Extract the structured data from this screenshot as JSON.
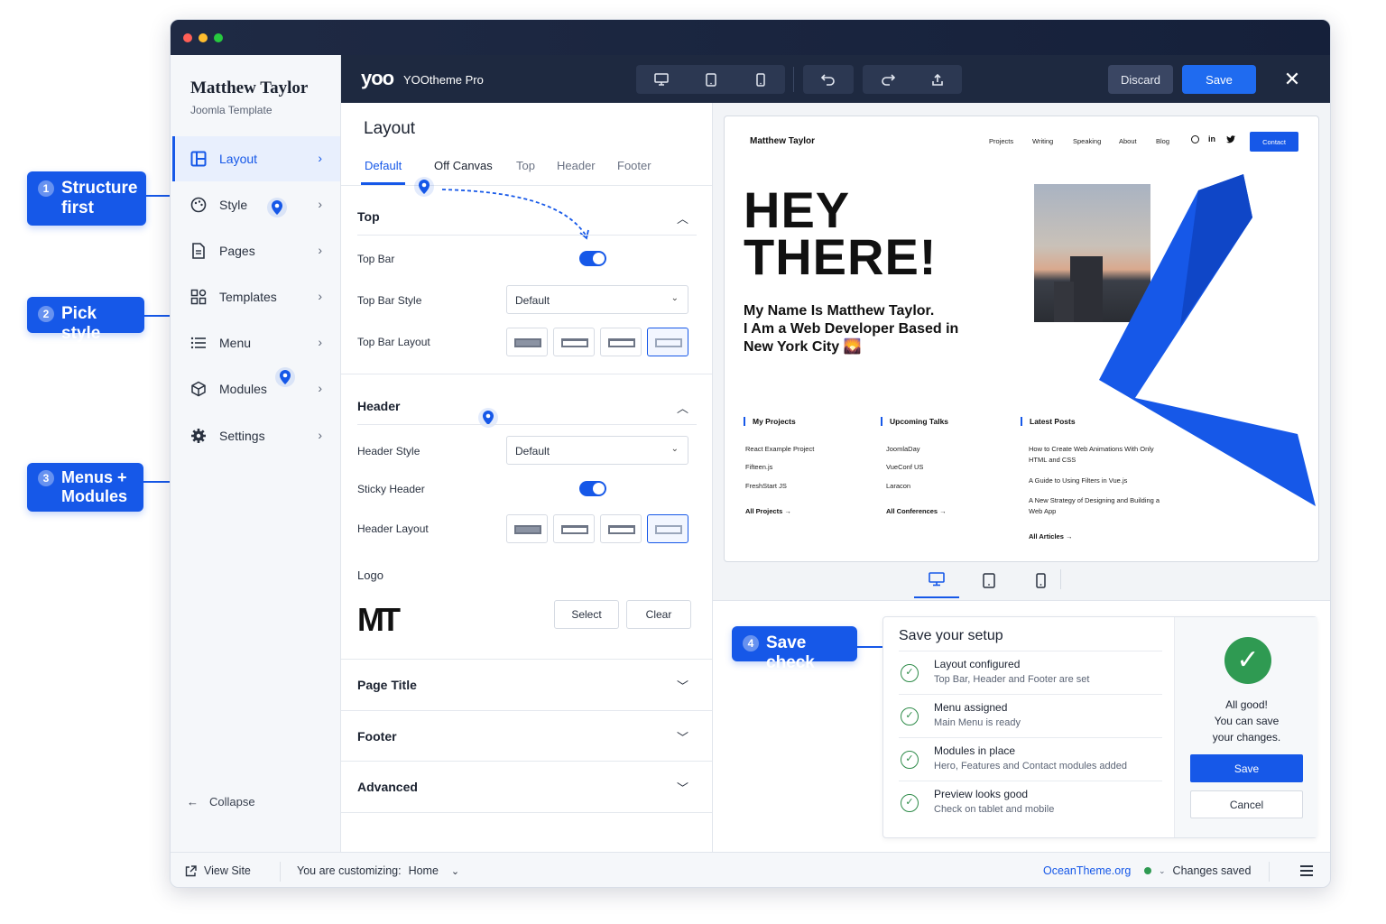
{
  "callouts": [
    {
      "num": "1",
      "text": "Structure\nfirst"
    },
    {
      "num": "2",
      "text": "Pick style"
    },
    {
      "num": "3",
      "text": "Menus +\nModules"
    },
    {
      "num": "4",
      "text": "Save check"
    }
  ],
  "sidebar": {
    "brand": "Matthew Taylor",
    "subtitle": "Joomla Template",
    "items": [
      {
        "label": "Layout",
        "icon": "layout-icon"
      },
      {
        "label": "Style",
        "icon": "palette-icon"
      },
      {
        "label": "Pages",
        "icon": "page-icon"
      },
      {
        "label": "Templates",
        "icon": "templates-icon"
      },
      {
        "label": "Menu",
        "icon": "menu-list-icon"
      },
      {
        "label": "Modules",
        "icon": "cube-icon"
      },
      {
        "label": "Settings",
        "icon": "gear-icon"
      }
    ],
    "collapse": "Collapse"
  },
  "toolbar": {
    "logo": "yoo",
    "product": "YOOtheme Pro",
    "discard": "Discard",
    "save": "Save"
  },
  "panel": {
    "title": "Layout",
    "tabs": [
      "Default",
      "Off Canvas",
      "Top",
      "Header",
      "Footer"
    ],
    "top": {
      "heading": "Top",
      "top_bar": "Top Bar",
      "top_bar_style": "Top Bar Style",
      "top_bar_style_value": "Default",
      "top_bar_layout": "Top Bar Layout"
    },
    "header": {
      "heading": "Header",
      "header_style": "Header Style",
      "header_style_value": "Default",
      "sticky_header": "Sticky Header",
      "header_layout": "Header Layout"
    },
    "logo": {
      "label": "Logo",
      "mark": "MT",
      "select": "Select",
      "clear": "Clear"
    },
    "collapsed_sections": [
      "Page Title",
      "Footer",
      "Advanced"
    ]
  },
  "preview": {
    "brand": "Matthew Taylor",
    "nav": [
      "Projects",
      "Writing",
      "Speaking",
      "About",
      "Blog"
    ],
    "contact": "Contact",
    "hero": "HEY\nTHERE!",
    "intro": "My Name Is Matthew Taylor.\nI Am a Web Developer Based in\nNew York City 🌄",
    "columns": [
      {
        "heading": "My Projects",
        "links": [
          "React Example Project",
          "Fifteen.js",
          "FreshStart JS"
        ],
        "all": "All Projects →"
      },
      {
        "heading": "Upcoming Talks",
        "links": [
          "JoomlaDay",
          "VueConf US",
          "Laracon"
        ],
        "all": "All Conferences →"
      },
      {
        "heading": "Latest Posts",
        "links": [
          "How to Create Web Animations With Only HTML and CSS",
          "A Guide to Using Filters in Vue.js",
          "A New Strategy of Designing and Building a Web App"
        ],
        "all": "All Articles →"
      }
    ]
  },
  "checklist": {
    "title": "Save your setup",
    "items": [
      {
        "title": "Layout configured",
        "sub": "Top Bar, Header and Footer are set"
      },
      {
        "title": "Menu assigned",
        "sub": "Main Menu is ready"
      },
      {
        "title": "Modules in place",
        "sub": "Hero, Features and Contact modules added"
      },
      {
        "title": "Preview looks good",
        "sub": "Check on tablet and mobile"
      }
    ],
    "status": "All good!\nYou can save\nyour changes.",
    "save": "Save",
    "cancel": "Cancel"
  },
  "footer": {
    "view_site": "View Site",
    "customizing_label": "You are customizing:",
    "customizing_value": "Home",
    "brand": "OceanTheme.org",
    "status": "Changes saved"
  },
  "colors": {
    "accent": "#1658e8",
    "toolbar": "#1e2940",
    "success": "#2f9a52"
  }
}
